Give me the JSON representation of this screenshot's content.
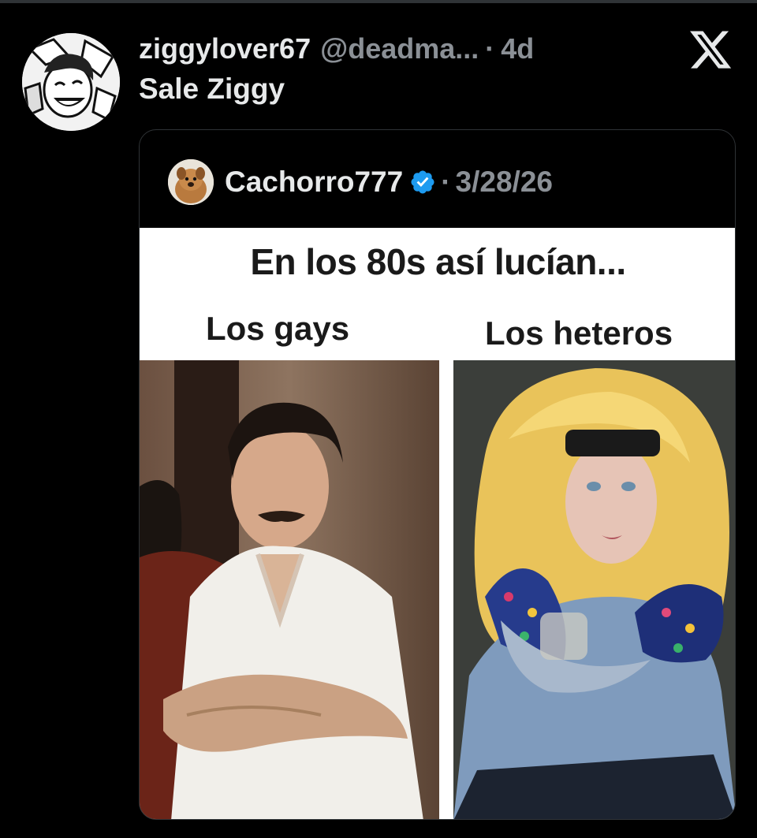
{
  "tweet": {
    "display_name": "ziggylover67",
    "handle": "@deadma...",
    "separator": "·",
    "time": "4d",
    "text": "Sale Ziggy",
    "avatar_icon": "cartoon-character-avatar"
  },
  "brand": {
    "logo_icon": "x-logo-icon",
    "logo_color": "#e7e9ea"
  },
  "quoted_tweet": {
    "display_name": "Cachorro777",
    "verified": true,
    "verified_color": "#1d9bf0",
    "separator": "·",
    "date": "3/28/26",
    "avatar_icon": "dog-avatar",
    "meme": {
      "title": "En los 80s así lucían...",
      "left_label": "Los gays",
      "right_label": "Los heteros"
    }
  },
  "colors": {
    "background": "#000000",
    "text_primary": "#e7e9ea",
    "text_secondary": "#8b9096",
    "border": "#2f3336"
  }
}
